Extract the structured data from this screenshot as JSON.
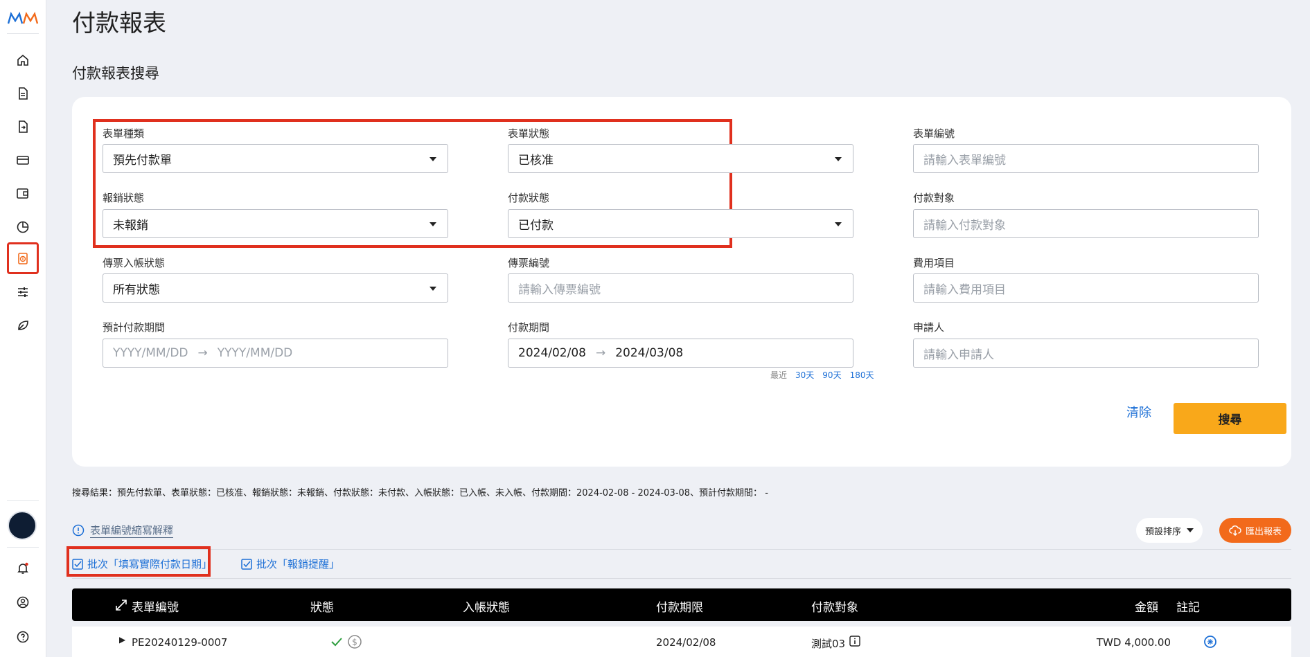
{
  "sidebar": {
    "items": [
      "home-icon",
      "document-icon",
      "document-export-icon",
      "credit-card-icon",
      "wallet-icon",
      "pie-chart-icon",
      "payment-report-icon",
      "sliders-icon",
      "leaf-icon"
    ],
    "bottom": [
      "bell-icon",
      "user-icon",
      "help-icon"
    ],
    "active": "payment-report-icon"
  },
  "page": {
    "title": "付款報表",
    "section_title": "付款報表搜尋"
  },
  "form": {
    "doc_type": {
      "label": "表單種類",
      "value": "預先付款單"
    },
    "doc_status": {
      "label": "表單狀態",
      "value": "已核准"
    },
    "doc_no": {
      "label": "表單編號",
      "placeholder": "請輸入表單編號"
    },
    "reimb_status": {
      "label": "報銷狀態",
      "value": "未報銷"
    },
    "pay_status": {
      "label": "付款狀態",
      "value": "已付款"
    },
    "payee": {
      "label": "付款對象",
      "placeholder": "請輸入付款對象"
    },
    "voucher_status": {
      "label": "傳票入帳狀態",
      "value": "所有狀態"
    },
    "voucher_no": {
      "label": "傳票編號",
      "placeholder": "請輸入傳票編號"
    },
    "expense_item": {
      "label": "費用項目",
      "placeholder": "請輸入費用項目"
    },
    "expected_period": {
      "label": "預計付款期間",
      "start_placeholder": "YYYY/MM/DD",
      "end_placeholder": "YYYY/MM/DD"
    },
    "pay_period": {
      "label": "付款期間",
      "start": "2024/02/08",
      "end": "2024/03/08"
    },
    "applicant": {
      "label": "申請人",
      "placeholder": "請輸入申請人"
    },
    "quick": {
      "prefix": "最近",
      "d30": "30天",
      "d90": "90天",
      "d180": "180天"
    },
    "clear_label": "清除",
    "search_label": "搜尋"
  },
  "results": {
    "summary": "搜尋結果：預先付款單、表單狀態：已核准、報銷狀態：未報銷、付款狀態：未付款、入帳狀態：已入帳、未入帳、付款期間：2024-02-08 - 2024-03-08、預計付款期間： -",
    "abbr_link": "表單編號縮寫解釋",
    "sort_label": "預設排序",
    "export_label": "匯出報表",
    "batch_pay_date": "批次「填寫實際付款日期」",
    "batch_reminder": "批次「報銷提醒」"
  },
  "table": {
    "headers": {
      "doc_no": "表單編號",
      "status": "狀態",
      "posting": "入帳狀態",
      "due": "付款期限",
      "payee": "付款對象",
      "amount": "金額",
      "note": "註記"
    },
    "rows": [
      {
        "doc_no": "PE20240129-0007",
        "due": "2024/02/08",
        "payee": "測試03",
        "amount": "TWD 4,000.00"
      }
    ]
  },
  "colors": {
    "accent": "#f9a81a",
    "export": "#f26a1b",
    "link": "#1c6fd6",
    "highlight": "#e0301e",
    "active_icon": "#f26a1b"
  }
}
